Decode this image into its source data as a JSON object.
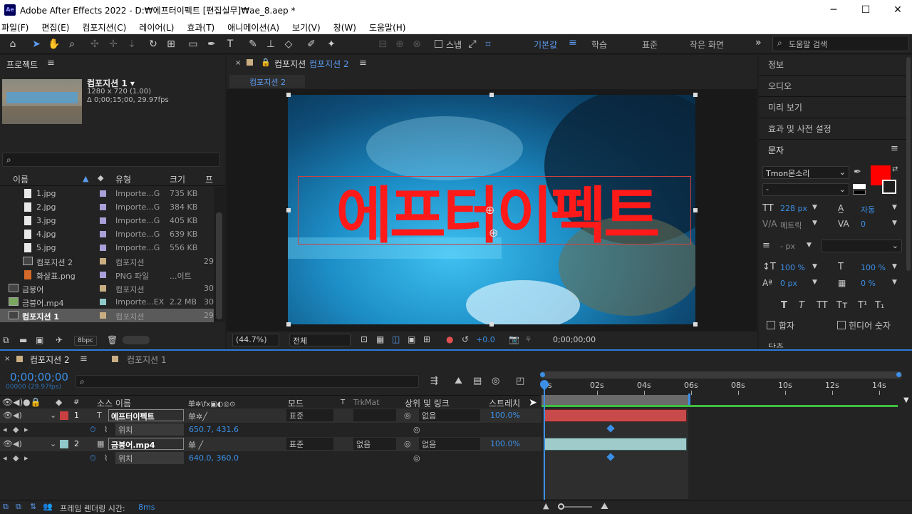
{
  "window": {
    "app_badge": "Ae",
    "title": "Adobe After Effects 2022 - D:₩에프터이펙트 [편집실무]₩ae_8.aep *",
    "minimize": "─",
    "maximize": "☐",
    "close": "✕"
  },
  "menu": [
    "파일(F)",
    "편집(E)",
    "컴포지션(C)",
    "레이어(L)",
    "효과(T)",
    "애니메이션(A)",
    "보기(V)",
    "창(W)",
    "도움말(H)"
  ],
  "toolbar": {
    "snap_label": "스냅",
    "workspaces": [
      "기본값",
      "학습",
      "표준",
      "작은 화면"
    ],
    "more": "»",
    "search_placeholder": "도움말 검색"
  },
  "project": {
    "title": "프로젝트",
    "comp_name": "컴포지션 1 ▾",
    "comp_size": "1280 x 720 (1.00)",
    "comp_duration": "Δ 0;00;15;00, 29.97fps",
    "search_icon": "⌕",
    "columns": [
      "이름",
      "유형",
      "크기",
      "프"
    ],
    "items": [
      {
        "name": "1.jpg",
        "type": "Importe...G",
        "size": "735 KB",
        "extra": "",
        "kind": "file",
        "color": "#a8a0d8"
      },
      {
        "name": "2.jpg",
        "type": "Importe...G",
        "size": "384 KB",
        "extra": "",
        "kind": "file",
        "color": "#a8a0d8"
      },
      {
        "name": "3.jpg",
        "type": "Importe...G",
        "size": "405 KB",
        "extra": "",
        "kind": "file",
        "color": "#a8a0d8"
      },
      {
        "name": "4.jpg",
        "type": "Importe...G",
        "size": "639 KB",
        "extra": "",
        "kind": "file",
        "color": "#a8a0d8"
      },
      {
        "name": "5.jpg",
        "type": "Importe...G",
        "size": "556 KB",
        "extra": "",
        "kind": "file",
        "color": "#a8a0d8"
      },
      {
        "name": "컴포지션 2",
        "type": "컴포지션",
        "size": "",
        "extra": "29",
        "kind": "comp",
        "color": "#c9ae82"
      },
      {
        "name": "화살표.png",
        "type": "PNG 파일",
        "size": "...이트",
        "extra": "",
        "kind": "png",
        "color": "#a8a0d8"
      },
      {
        "name": "금붕어",
        "type": "컴포지션",
        "size": "",
        "extra": "30",
        "kind": "comp",
        "color": "#c9ae82"
      },
      {
        "name": "금붕어.mp4",
        "type": "Importe...EX",
        "size": "2.2 MB",
        "extra": "30",
        "kind": "video",
        "color": "#8fc9c9"
      },
      {
        "name": "컴포지션 1",
        "type": "컴포지션",
        "size": "",
        "extra": "29",
        "kind": "comp",
        "color": "#c9ae82"
      }
    ],
    "bpc": "8bpc"
  },
  "viewer": {
    "tab_label": "컴포지션",
    "tab_comp": "컴포지션 2",
    "breadcrumb": "컴포지션 2",
    "overlay_text": "에프터이펙트",
    "overlay_color": "#ff1a1a",
    "zoom": "(44.7%)",
    "resolution": "전체",
    "exposure": "+0.0",
    "timecode": "0;00;00;00"
  },
  "right_panel": {
    "items": [
      "정보",
      "오디오",
      "미리 보기",
      "효과 및 사전 설정"
    ],
    "char_title": "문자",
    "font": "Tmon몬소리",
    "style": "-",
    "fill_color": "#ff0000",
    "size": "228 px",
    "leading": "자동",
    "kerning": "메트릭",
    "tracking": "0",
    "stroke_width": "- px",
    "vscale": "100 %",
    "hscale": "100 %",
    "baseline": "0 px",
    "tsume": "0 %",
    "style_buttons": [
      "T",
      "T",
      "TT",
      "Tт",
      "T¹",
      "T₁"
    ],
    "ligatures": "합자",
    "hindi": "힌디어 숫자",
    "paragraph": "단추"
  },
  "timeline": {
    "tab_active": "컴포지션 2",
    "tab_other": "컴포지션 1",
    "timecode": "0;00;00;00",
    "fps": "00000 (29.97fps)",
    "columns": {
      "num": "#",
      "source": "소스 이름",
      "switches": "单✲\\fx▣◐◎⊙",
      "mode": "모드",
      "t": "T",
      "trkmat": "TrkMat",
      "parent": "상위 및 링크",
      "stretch": "스트레치"
    },
    "layers": [
      {
        "num": "1",
        "type_icon": "T",
        "name": "에프터이펙트",
        "mode": "표준",
        "trkmat": "",
        "parent": "없음",
        "stretch": "100.0%",
        "color": "#c94040",
        "prop": "위치",
        "prop_value": "650.7, 431.6"
      },
      {
        "num": "2",
        "type_icon": "▦",
        "name": "금붕어.mp4",
        "mode": "표준",
        "trkmat": "없음",
        "parent": "없음",
        "stretch": "100.0%",
        "color": "#8fc9c9",
        "prop": "위치",
        "prop_value": "640.0, 360.0"
      }
    ],
    "ruler": [
      "0s",
      "02s",
      "04s",
      "06s",
      "08s",
      "10s",
      "12s",
      "14s"
    ],
    "render_time_label": "프레임 렌더링 시간:",
    "render_time": "8ms"
  }
}
